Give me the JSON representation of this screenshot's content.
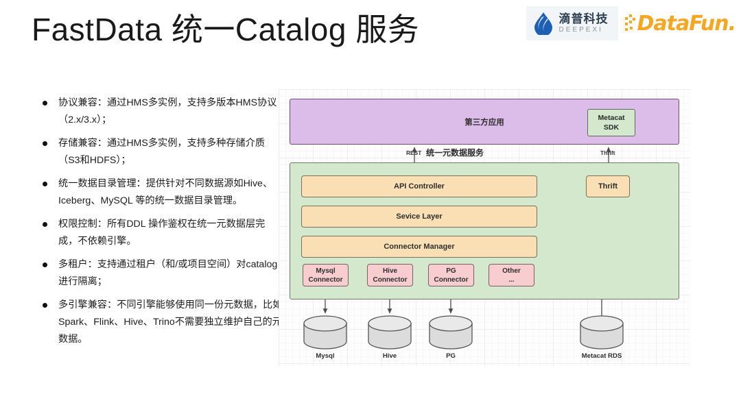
{
  "header": {
    "title": "FastData 统一Catalog 服务",
    "logos": [
      {
        "name": "deepexi",
        "cn": "滴普科技",
        "en": "DEEPEXI"
      },
      {
        "name": "datafun",
        "text": "DataFun."
      }
    ],
    "colors": {
      "deepexi_blue": "#1c5fb4",
      "datafun_orange": "#f5a623"
    }
  },
  "bullets": [
    "协议兼容：通过HMS多实例，支持多版本HMS协议（2.x/3.x）；",
    "存储兼容：通过HMS多实例，支持多种存储介质（S3和HDFS）；",
    "统一数据目录管理：提供针对不同数据源如Hive、Iceberg、MySQL 等的统一数据目录管理。",
    "权限控制：所有DDL 操作鉴权在统一元数据层完成，不依赖引擎。",
    "多租户：支持通过租户（和/或项目空间）对catalog进行隔离；",
    "多引擎兼容：不同引擎能够使用同一份元数据，比如Spark、Flink、Hive、Trino不需要独立维护自己的元数据。"
  ],
  "diagram": {
    "top_panel": {
      "label": "第三方应用",
      "sdk_box": "Metacat\nSDK",
      "sdk_line1": "Metacat",
      "sdk_line2": "SDK",
      "color": "#dcbde9"
    },
    "middle_label": "统一元数据服务",
    "arrows": [
      {
        "label": "REST"
      },
      {
        "label": "Thrift"
      }
    ],
    "service_panel": {
      "color": "#d3e8cd",
      "layers": [
        {
          "label": "API Controller"
        },
        {
          "label": "Sevice Layer"
        },
        {
          "label": "Connector Manager"
        }
      ],
      "thrift_box": "Thrift",
      "connectors": [
        {
          "line1": "Mysql",
          "line2": "Connector"
        },
        {
          "line1": "Hive",
          "line2": "Connector"
        },
        {
          "line1": "PG",
          "line2": "Connector"
        },
        {
          "line1": "Other",
          "line2": "..."
        }
      ]
    },
    "databases": [
      {
        "label": "Mysql"
      },
      {
        "label": "Hive"
      },
      {
        "label": "PG"
      },
      {
        "label": "Metacat RDS"
      }
    ],
    "colors": {
      "orange": "#fadfb5",
      "pink": "#f7cdd0",
      "green": "#d3e8cd",
      "purple": "#dcbde9",
      "cylinder": "#dcdcdc"
    }
  }
}
